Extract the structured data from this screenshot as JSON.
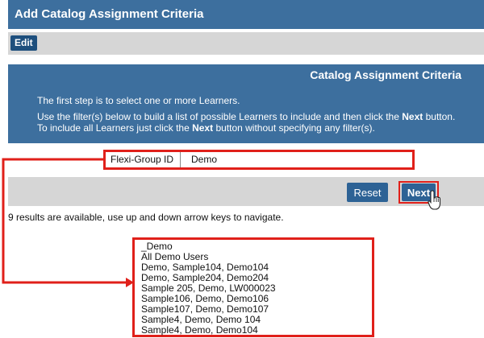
{
  "window": {
    "title": "Add Catalog Assignment Criteria"
  },
  "toolbar": {
    "edit_label": "Edit"
  },
  "info_panel": {
    "heading": "Catalog Assignment Criteria",
    "line1": "The first step is to select one or more Learners.",
    "line2_pre": "Use the filter(s) below to build a list of possible Learners to include and then click the ",
    "line2_bold": "Next",
    "line2_post": " button.",
    "line3_pre": "To include all Learners just click the ",
    "line3_bold": "Next",
    "line3_post": " button without specifying any filter(s)."
  },
  "filter": {
    "label": "Flexi-Group ID",
    "value": "Demo"
  },
  "actions": {
    "reset_label": "Reset",
    "next_label": "Next"
  },
  "results": {
    "status": "9 results are available, use up and down arrow keys to navigate.",
    "items": [
      "_Demo",
      "All Demo Users",
      "Demo, Sample104, Demo104",
      "Demo, Sample204, Demo204",
      "Sample 205, Demo, LW000023",
      "Sample106, Demo, Demo106",
      "Sample107, Demo, Demo107",
      "Sample4, Demo, Demo 104",
      "Sample4, Demo, Demo104"
    ]
  },
  "colors": {
    "header_blue": "#3d6f9e",
    "button_blue": "#2d6295",
    "highlight_red": "#e0201a",
    "bar_gray": "#d6d6d6"
  },
  "icons": {
    "cursor": "hand-pointer-icon"
  }
}
